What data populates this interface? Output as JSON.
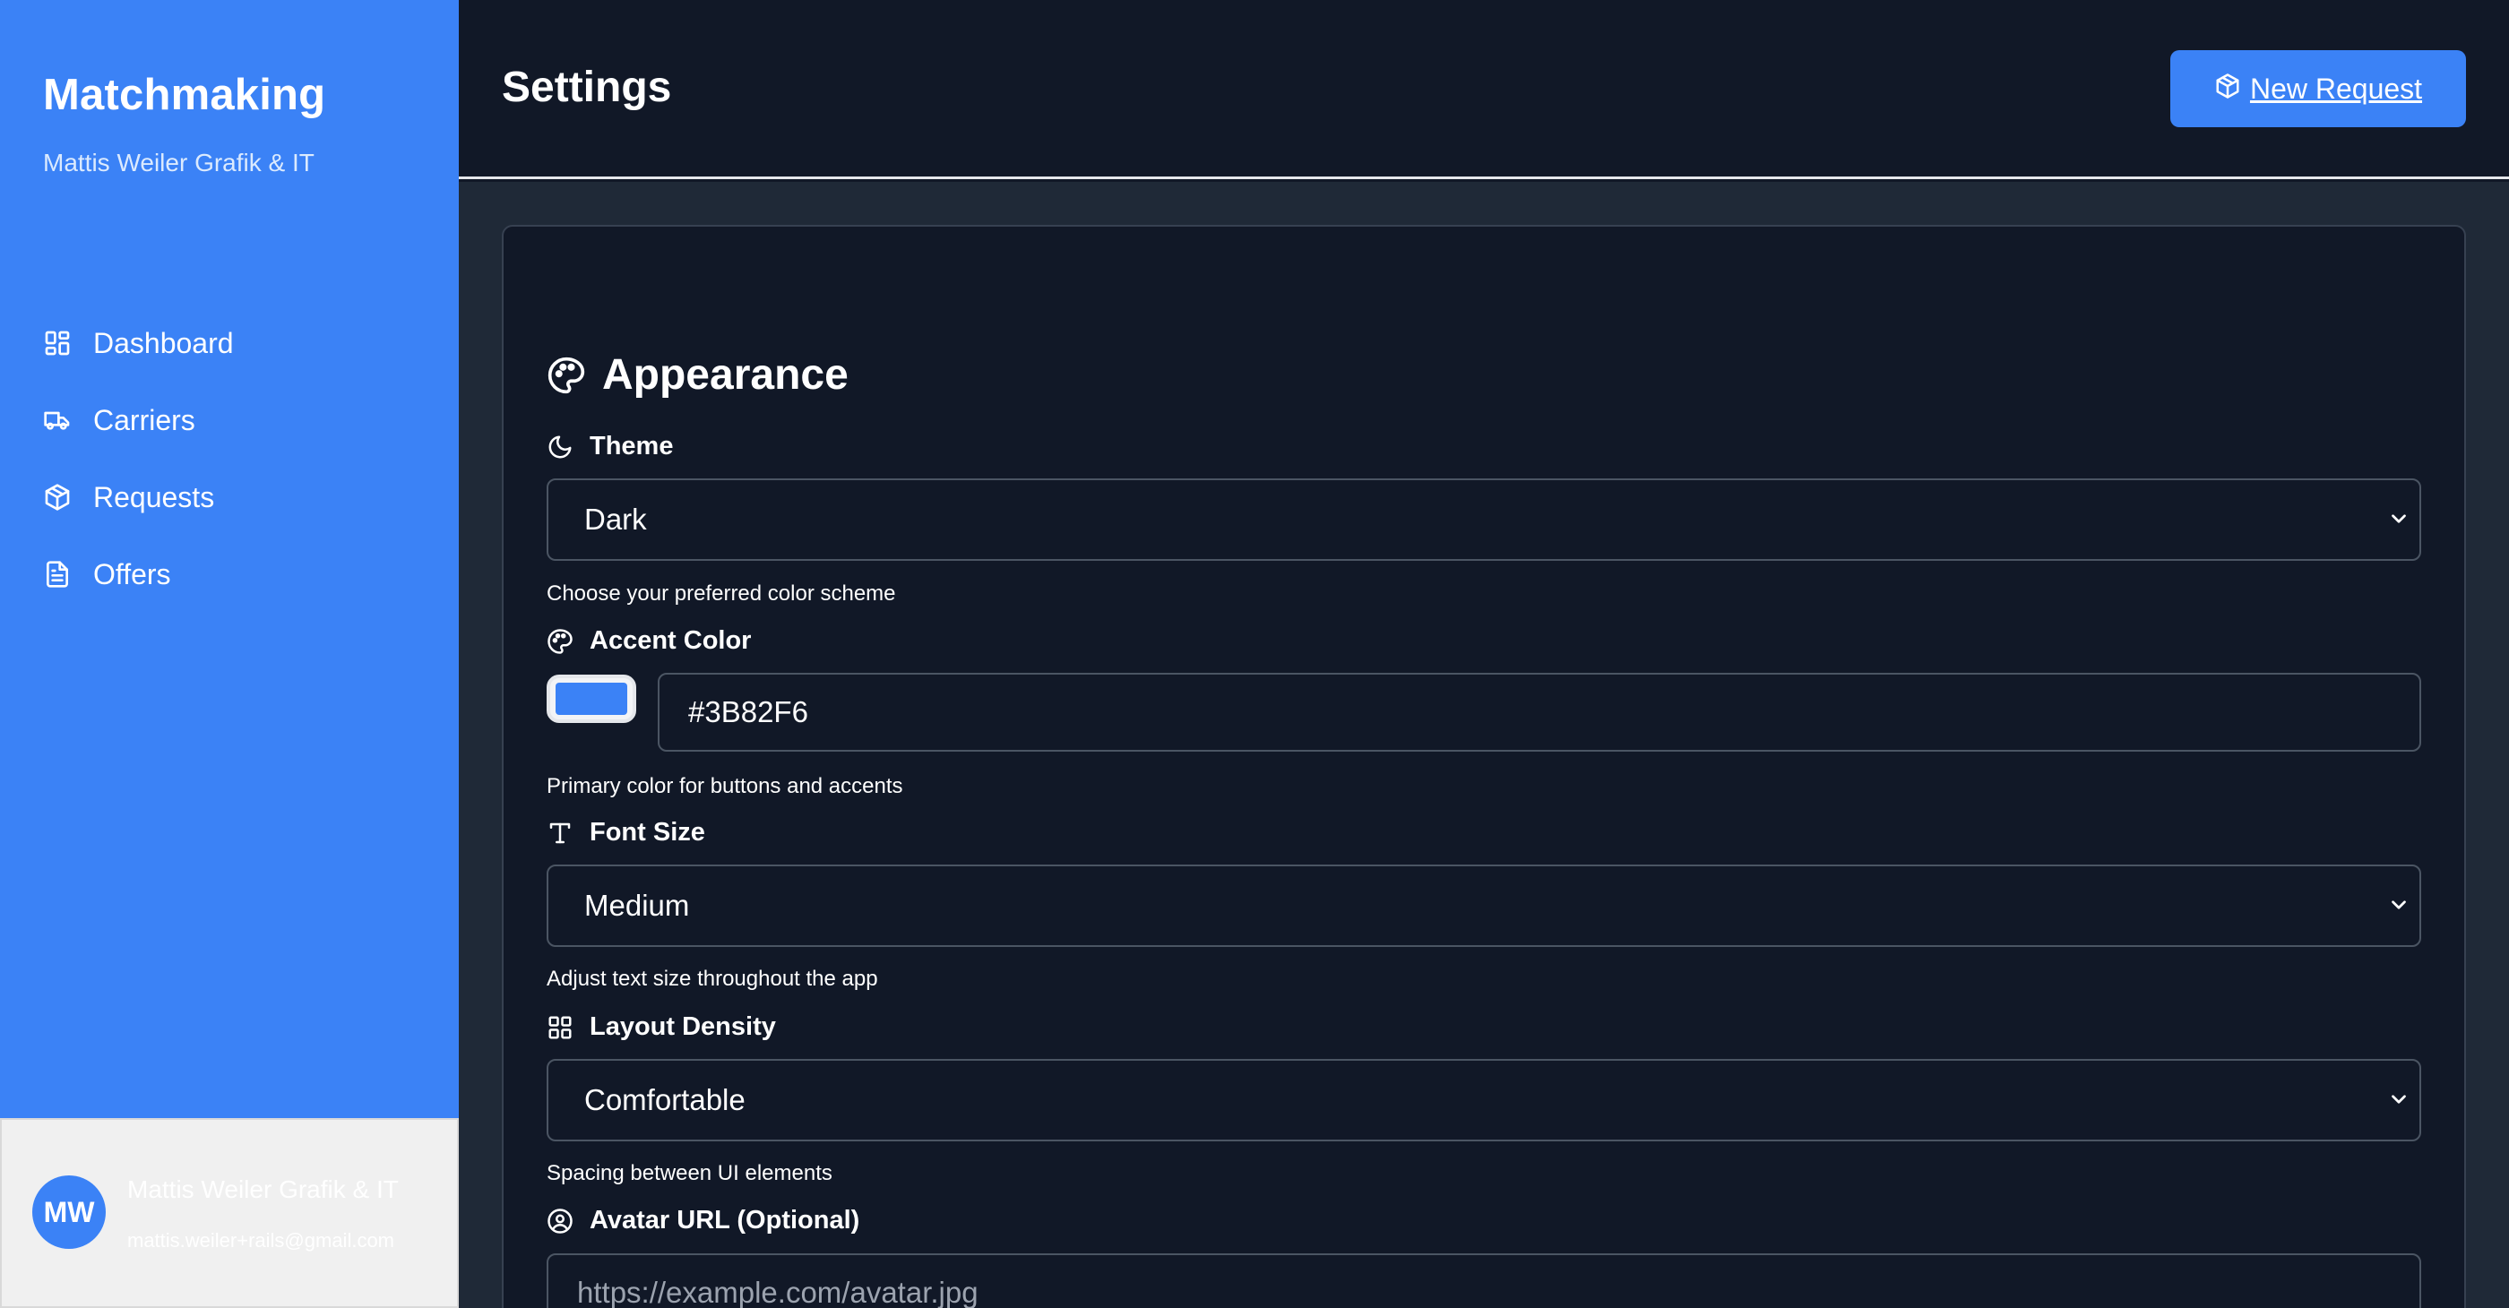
{
  "sidebar": {
    "title": "Matchmaking",
    "subtitle": "Mattis Weiler Grafik & IT",
    "items": [
      {
        "label": "Dashboard",
        "icon": "dashboard-icon"
      },
      {
        "label": "Carriers",
        "icon": "truck-icon"
      },
      {
        "label": "Requests",
        "icon": "package-icon"
      },
      {
        "label": "Offers",
        "icon": "document-icon"
      }
    ],
    "user": {
      "initials": "MW",
      "name": "Mattis Weiler Grafik & IT",
      "email": "mattis.weiler+rails@gmail.com"
    }
  },
  "header": {
    "title": "Settings",
    "new_request_label": "New Request"
  },
  "appearance": {
    "title": "Appearance",
    "theme": {
      "label": "Theme",
      "value": "Dark",
      "hint": "Choose your preferred color scheme"
    },
    "accent": {
      "label": "Accent Color",
      "value": "#3B82F6",
      "hint": "Primary color for buttons and accents"
    },
    "font_size": {
      "label": "Font Size",
      "value": "Medium",
      "hint": "Adjust text size throughout the app"
    },
    "density": {
      "label": "Layout Density",
      "value": "Comfortable",
      "hint": "Spacing between UI elements"
    },
    "avatar_url": {
      "label": "Avatar URL (Optional)",
      "placeholder": "https://example.com/avatar.jpg"
    }
  },
  "colors": {
    "accent": "#3B82F6",
    "background": "#111827",
    "panel": "#1f2937",
    "border": "#4b5563"
  }
}
